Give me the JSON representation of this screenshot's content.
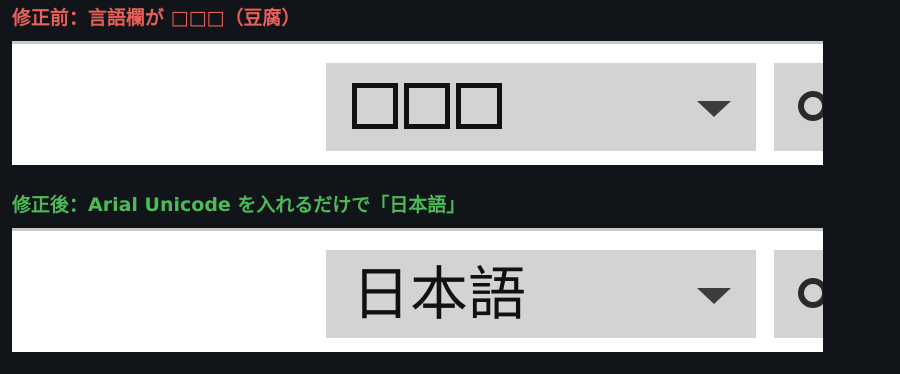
{
  "before": {
    "caption": "修正前：言語欄が □□□（豆腐）",
    "dropdown_value": "□□□",
    "dropdown_icon": "chevron-down-icon",
    "side_icon": "gear-icon"
  },
  "after": {
    "caption": "修正後：Arial Unicode を入れるだけで「日本語」",
    "dropdown_value": "日本語",
    "dropdown_icon": "chevron-down-icon",
    "side_icon": "gear-icon"
  },
  "colors": {
    "background": "#111418",
    "before_caption": "#e8605a",
    "after_caption": "#4cbb57",
    "dropdown_bg": "#d3d3d3",
    "panel_bg": "#ffffff"
  }
}
